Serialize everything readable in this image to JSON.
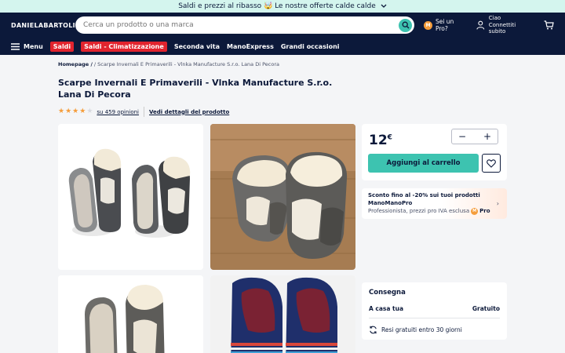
{
  "promo": {
    "text": "Saldi e prezzi al ribasso 🤯 Le nostre offerte calde calde",
    "chevron": "chevron-down-icon"
  },
  "header": {
    "logo": "DANIELABARTOLI.IT",
    "search_placeholder": "Cerca un prodotto o una marca",
    "pro_badge": "M",
    "pro_label": "Sei un Pro?",
    "account_line1": "Ciao",
    "account_line2": "Connettiti subito"
  },
  "nav": {
    "menu_label": "Menu",
    "items": [
      "Saldi",
      "Saldi - Climatizzazione",
      "Seconda vita",
      "ManoExpress",
      "Grandi occasioni"
    ]
  },
  "breadcrumb": {
    "home": "Homepage /",
    "rest": " / Scarpe Invernali E Primaverili - Vlnka Manufacture S.r.o. Lana Di Pecora"
  },
  "product": {
    "title": "Scarpe Invernali E Primaverili - Vlnka Manufacture S.r.o. Lana Di Pecora",
    "rating_value": 4,
    "rating_max": 5,
    "reviews_label": "su 459 opinioni",
    "details_label": "Vedi dettagli del prodotto"
  },
  "buy": {
    "price_int": "12",
    "price_currency": "€",
    "qty_minus": "−",
    "qty_plus": "+",
    "add_to_cart": "Aggiungi al carrello"
  },
  "pro_offer": {
    "title": "Sconto fino al -20% sui tuoi prodotti ManoManoPro",
    "subtitle": "Professionista, prezzi pro IVA esclusa",
    "badge_text": "Pro",
    "badge_letter": "M",
    "arrow": "›"
  },
  "delivery": {
    "title": "Consegna",
    "home_label": "A casa tua",
    "home_value": "Gratuito",
    "returns": "Resi gratuiti entro 30 giorni"
  },
  "colors": {
    "navy": "#0c193a",
    "teal": "#3dc3b0",
    "promo_bg": "#d4f5ee",
    "red": "#e2242e",
    "orange": "#f59d3b"
  }
}
